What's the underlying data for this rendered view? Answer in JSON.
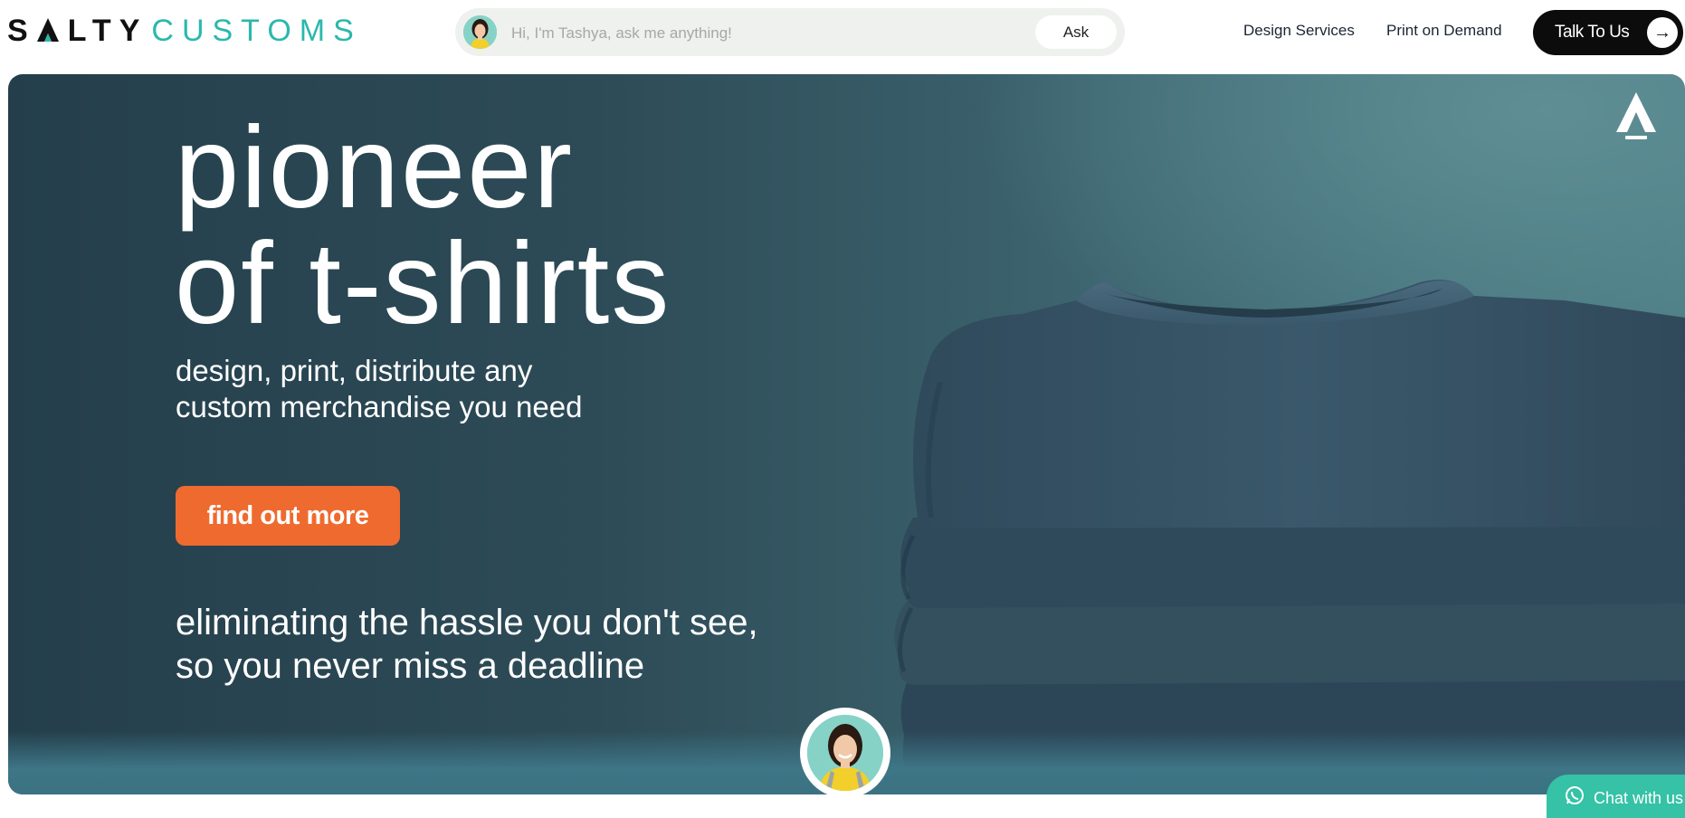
{
  "header": {
    "logo": {
      "part1": "S",
      "part2": "LTY",
      "part3": "CUSTOMS"
    },
    "ask": {
      "placeholder": "Hi, I'm Tashya, ask me anything!",
      "button_label": "Ask"
    },
    "nav": [
      {
        "label": "Design Services"
      },
      {
        "label": "Print on Demand"
      }
    ],
    "talk_button": {
      "label": "Talk To Us",
      "icon": "arrow-right-icon"
    }
  },
  "hero": {
    "headline": [
      "pioneer",
      "of t-shirts"
    ],
    "subline": [
      "design, print, distribute any",
      "custom merchandise you need"
    ],
    "cta_label": "find out more",
    "tagline": [
      "eliminating the hassle you don't see,",
      "so you never miss a deadline"
    ]
  },
  "chat_widget": {
    "label": "Chat with us",
    "icon": "whatsapp-icon"
  },
  "colors": {
    "brand_teal": "#2bb8ad",
    "cta_orange": "#ef6a2f",
    "hero_bg": "#2d4b57",
    "chat_green": "#35c2a6"
  }
}
